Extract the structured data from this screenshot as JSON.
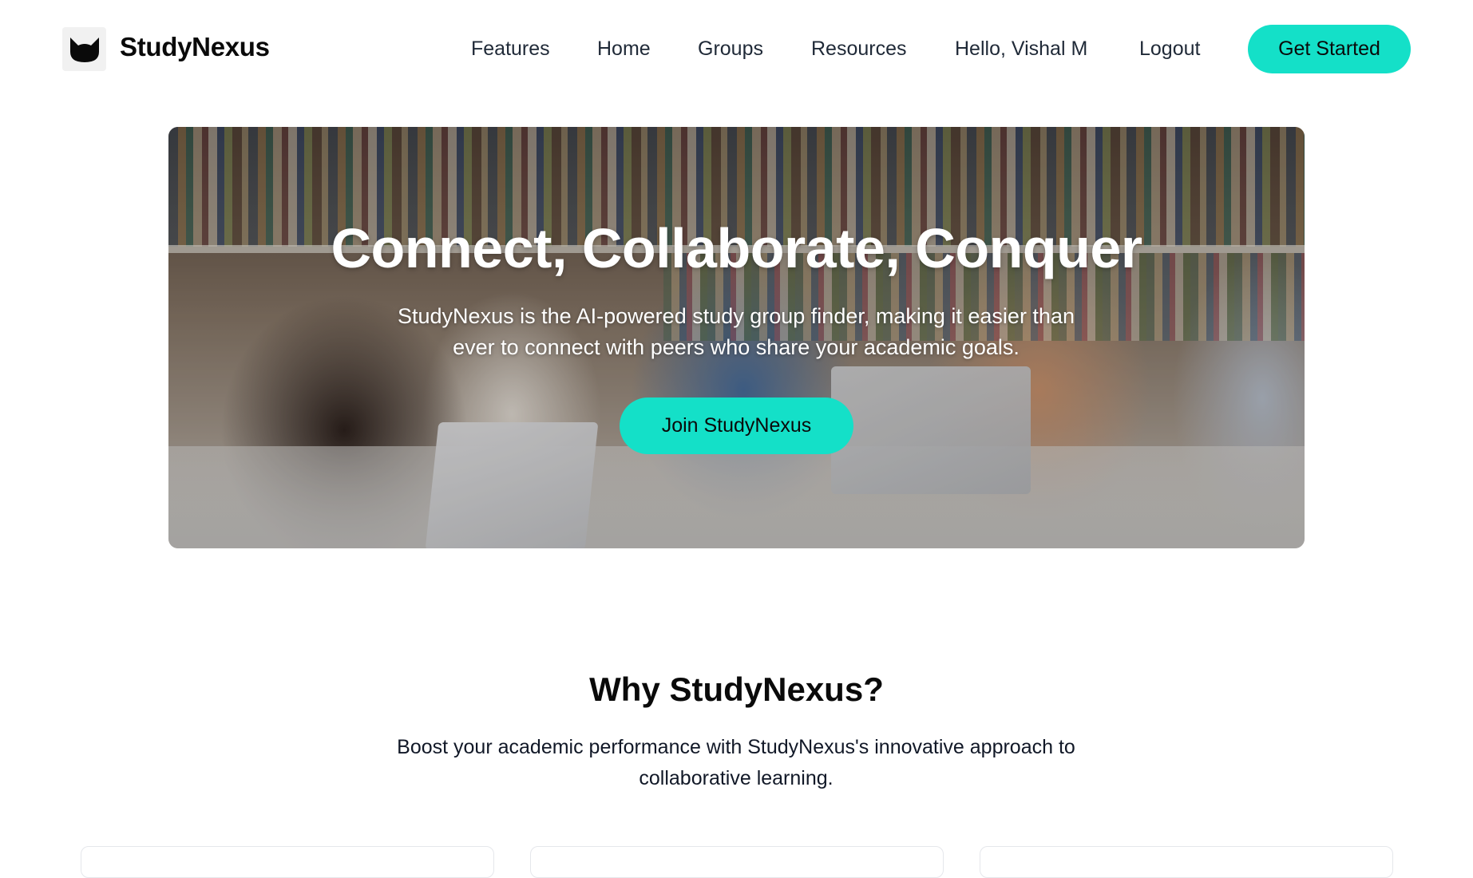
{
  "brand": {
    "name": "StudyNexus",
    "logo_icon": "cat-head-icon"
  },
  "nav": {
    "links": [
      {
        "label": "Features"
      },
      {
        "label": "Home"
      },
      {
        "label": "Groups"
      },
      {
        "label": "Resources"
      },
      {
        "label": "Hello, Vishal M"
      },
      {
        "label": "Logout"
      }
    ],
    "cta_label": "Get Started"
  },
  "hero": {
    "title": "Connect, Collaborate, Conquer",
    "subtitle": "StudyNexus is the AI-powered study group finder, making it easier than ever to connect with peers who share your academic goals.",
    "cta_label": "Join StudyNexus"
  },
  "why": {
    "title": "Why StudyNexus?",
    "subtitle": "Boost your academic performance with StudyNexus's innovative approach to collaborative learning."
  },
  "colors": {
    "accent": "#14e0c8",
    "text": "#111827"
  }
}
